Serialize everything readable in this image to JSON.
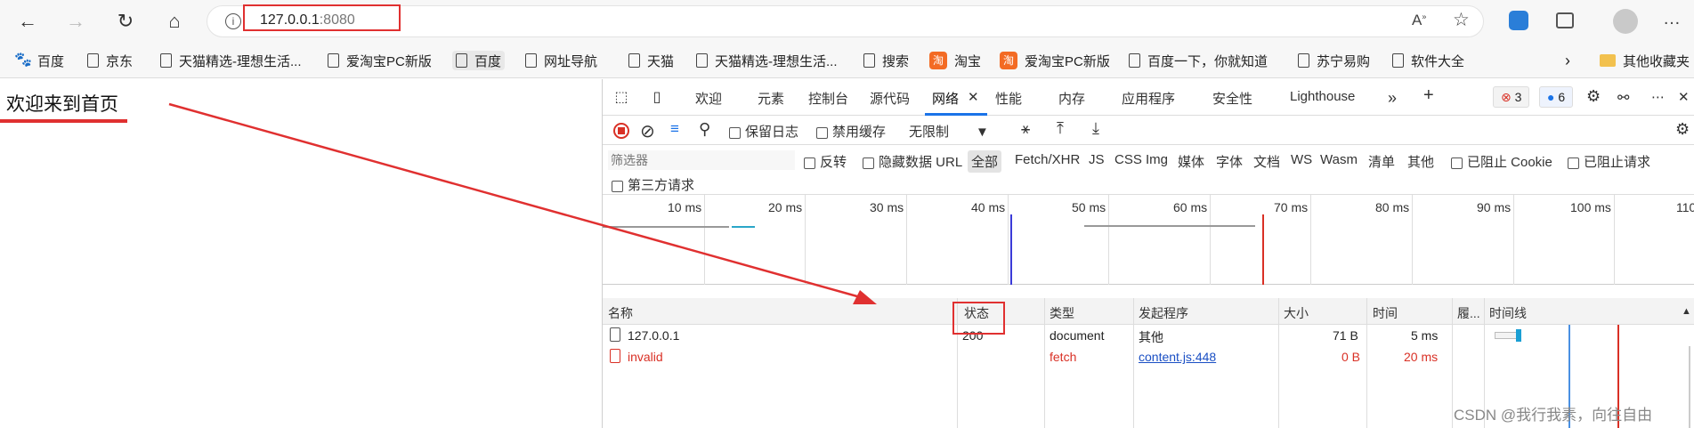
{
  "browser": {
    "url_host": "127.0.0.1",
    "url_port": ":8080"
  },
  "bookmarks": [
    {
      "label": "百度",
      "icon": "paw-icon"
    },
    {
      "label": "京东",
      "icon": "page-icon"
    },
    {
      "label": "天猫精选-理想生活...",
      "icon": "page-icon"
    },
    {
      "label": "爱淘宝PC新版",
      "icon": "page-icon"
    },
    {
      "label": "百度",
      "icon": "page-icon"
    },
    {
      "label": "网址导航",
      "icon": "page-icon"
    },
    {
      "label": "天猫",
      "icon": "page-icon"
    },
    {
      "label": "天猫精选-理想生活...",
      "icon": "page-icon"
    },
    {
      "label": "搜索",
      "icon": "page-icon"
    },
    {
      "label": "淘宝",
      "icon": "taobao-icon"
    },
    {
      "label": "爱淘宝PC新版",
      "icon": "taobao-icon"
    },
    {
      "label": "百度一下，你就知道",
      "icon": "page-icon"
    },
    {
      "label": "苏宁易购",
      "icon": "page-icon"
    },
    {
      "label": "软件大全",
      "icon": "page-icon"
    }
  ],
  "bookmarks_other": "其他收藏夹",
  "page": {
    "welcome": "欢迎来到首页"
  },
  "devtools": {
    "tabs": [
      "欢迎",
      "元素",
      "控制台",
      "源代码",
      "网络",
      "性能",
      "内存",
      "应用程序",
      "安全性",
      "Lighthouse"
    ],
    "active_tab": "网络",
    "errors_count": "3",
    "messages_count": "6",
    "toolbar": {
      "preserve_log": "保留日志",
      "disable_cache": "禁用缓存",
      "throttle": "无限制"
    },
    "filter": {
      "placeholder": "筛选器",
      "invert": "反转",
      "hide_data_url": "隐藏数据 URL",
      "types": [
        "全部",
        "Fetch/XHR",
        "JS",
        "CSS",
        "Img",
        "媒体",
        "字体",
        "文档",
        "WS",
        "Wasm",
        "清单",
        "其他"
      ],
      "blocked_cookies": "已阻止 Cookie",
      "blocked_requests": "已阻止请求",
      "third_party": "第三方请求"
    },
    "overview_ticks": [
      "10 ms",
      "20 ms",
      "30 ms",
      "40 ms",
      "50 ms",
      "60 ms",
      "70 ms",
      "80 ms",
      "90 ms",
      "100 ms",
      "110"
    ],
    "columns": [
      "名称",
      "状态",
      "类型",
      "发起程序",
      "大小",
      "时间",
      "履...",
      "时间线"
    ],
    "rows": [
      {
        "name": "127.0.0.1",
        "status": "200",
        "type": "document",
        "initiator": "其他",
        "size": "71 B",
        "time": "5 ms",
        "error": false
      },
      {
        "name": "invalid",
        "status": "",
        "type": "fetch",
        "initiator": "content.js:448",
        "size": "0 B",
        "time": "20 ms",
        "error": true
      }
    ]
  },
  "watermark": "CSDN @我行我素，向往自由",
  "colors": {
    "highlight": "#e03030",
    "accent": "#1a73e8",
    "error": "#d93025"
  }
}
